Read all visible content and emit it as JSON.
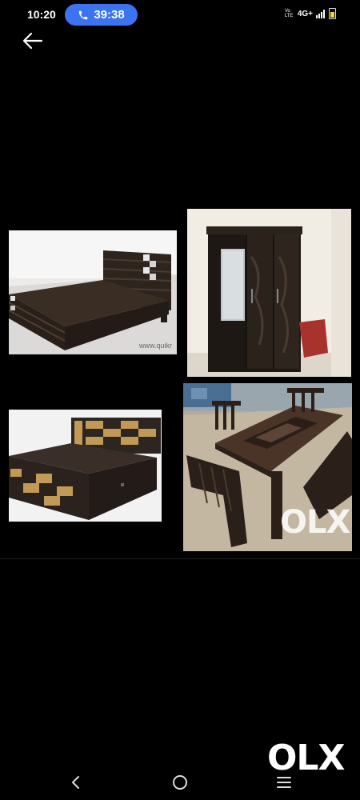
{
  "status_bar": {
    "time": "10:20",
    "call_duration": "39:38",
    "network_label": "4G+",
    "volte_label": "Vo LTE"
  },
  "photos": {
    "bed1_watermark": "www.quikr"
  },
  "watermark": {
    "olx": "OLX"
  },
  "logo": {
    "olx": "OLX"
  },
  "colors": {
    "call_pill": "#3b73f0",
    "background": "#000000"
  },
  "icons": {
    "back": "arrow-left",
    "phone": "phone",
    "nav_back": "chevron-left",
    "nav_home": "circle",
    "nav_menu": "hamburger"
  }
}
